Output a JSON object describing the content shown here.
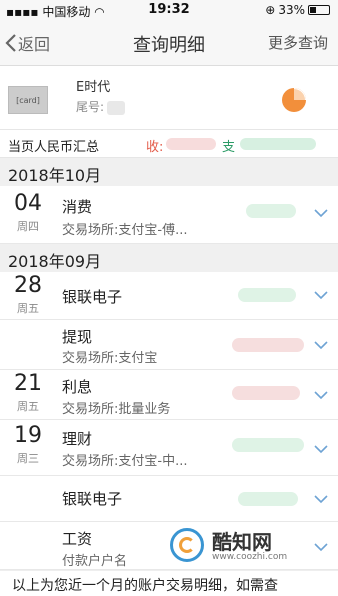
{
  "status_bar": {
    "carrier": "中国移动",
    "time": "19:32",
    "battery_pct": 33,
    "battery_text": "33%"
  },
  "nav": {
    "back_label": "返回",
    "title": "查询明细",
    "more_label": "更多查询"
  },
  "card": {
    "name": "E时代",
    "tail_label": "尾号:"
  },
  "summary": {
    "label": "当页人民币汇总",
    "income_label": "收:",
    "expense_label": "支"
  },
  "months": [
    {
      "label": "2018年10月",
      "entries": [
        {
          "day": "04",
          "weekday": "周四",
          "type": "消费",
          "place": "交易场所:支付宝-傅...",
          "amount_color": "green"
        }
      ]
    },
    {
      "label": "2018年09月",
      "entries": [
        {
          "day": "28",
          "weekday": "周五",
          "type": "银联电子",
          "place": "",
          "amount_color": "green"
        },
        {
          "day": "",
          "weekday": "",
          "type": "提现",
          "place": "交易场所:支付宝",
          "amount_color": "red"
        },
        {
          "day": "21",
          "weekday": "周五",
          "type": "利息",
          "place": "交易场所:批量业务",
          "amount_color": "red"
        },
        {
          "day": "19",
          "weekday": "周三",
          "type": "理财",
          "place": "交易场所:支付宝-中...",
          "amount_color": "green"
        },
        {
          "day": "",
          "weekday": "",
          "type": "银联电子",
          "place": "",
          "amount_color": "green"
        },
        {
          "day": "",
          "weekday": "",
          "type": "工资",
          "place": "付款户户名",
          "amount_color": "green"
        }
      ]
    }
  ],
  "footer": {
    "text": "以上为您近一个月的账户交易明细，如需查"
  },
  "watermark": {
    "name": "酷知网",
    "url": "www.coozhi.com"
  }
}
